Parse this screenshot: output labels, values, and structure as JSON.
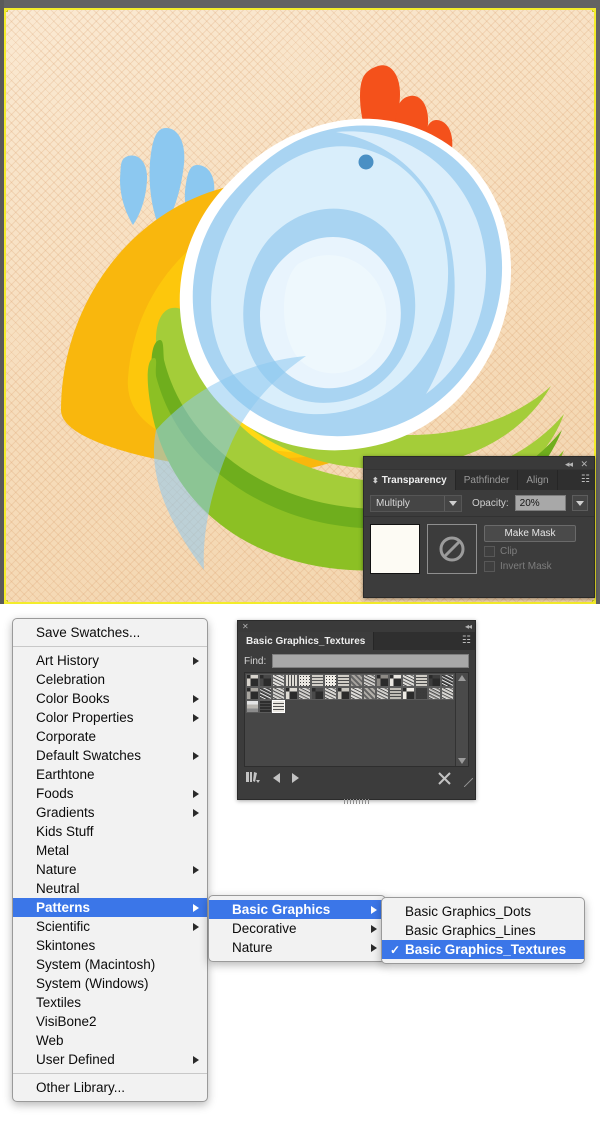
{
  "canvas": {
    "name": "artboard-illustration",
    "background_color": "#f6dfc0",
    "selection_border_color": "#f3ec2a",
    "app_chrome_color": "#636363",
    "artwork_description": "bird-illustration",
    "palette": {
      "orange_crest": "#f4511b",
      "orange_beak": "#ef4a12",
      "orange_beak_dark": "#cf3a13",
      "yellow_body": "#fdc70c",
      "yellow_body_light": "#ffd915",
      "yellow_deep": "#f9b70d",
      "blue_light": "#d9eefb",
      "blue_mid": "#a9d4f2",
      "blue_pale": "#e8f4fd",
      "blue_splash": "#8cc8f0",
      "blue_eye": "#4a90c4",
      "green_light": "#a4cd39",
      "green_mid": "#8cc024",
      "green_dark": "#6fae1d",
      "white_rim": "#ffffff"
    }
  },
  "transparency_panel": {
    "name": "transparency-panel",
    "collapse_icon": "◂◂",
    "close_icon": "✕",
    "menu_icon": "☷",
    "diamond_icon": "⬍",
    "tabs": [
      {
        "label": "Transparency",
        "active": true
      },
      {
        "label": "Pathfinder",
        "active": false
      },
      {
        "label": "Align",
        "active": false
      }
    ],
    "blend_mode": "Multiply",
    "opacity_label": "Opacity:",
    "opacity_value": "20%",
    "make_mask_label": "Make Mask",
    "clip_label": "Clip",
    "clip_checked": false,
    "invert_mask_label": "Invert Mask",
    "invert_mask_checked": false,
    "fill_thumb_color": "#fdfbf4",
    "mask_thumb_icon": "no-mask-symbol"
  },
  "swatch_library_panel": {
    "name": "swatch-library-panel",
    "close_icon": "✕",
    "collapse_icon": "◂◂",
    "menu_icon": "☷",
    "tab_title": "Basic Graphics_Textures",
    "find_label": "Find:",
    "find_value": "",
    "find_placeholder": "",
    "library_icon": "library-stack-icon",
    "prev_icon": "previous-library-arrow",
    "next_icon": "next-library-arrow",
    "delete_icon": "delete-swatch-icon",
    "resize_icon": "resize-grip-icon",
    "swatch_count": 35,
    "columns": 16,
    "swatches": [
      {
        "tone": "#d8d4cd",
        "pat": "speckle"
      },
      {
        "tone": "#484848",
        "pat": "speckle"
      },
      {
        "tone": "#e4e1db",
        "pat": "noise"
      },
      {
        "tone": "#dedbd4",
        "pat": "vlines"
      },
      {
        "tone": "#e8e5df",
        "pat": "dots"
      },
      {
        "tone": "#d2cfc8",
        "pat": "grid"
      },
      {
        "tone": "#eeebe5",
        "pat": "dots"
      },
      {
        "tone": "#d0cdc6",
        "pat": "hlines"
      },
      {
        "tone": "#a8a5a0",
        "pat": "diag"
      },
      {
        "tone": "#bab7b1",
        "pat": "noise"
      },
      {
        "tone": "#8d8a85",
        "pat": "speckle"
      },
      {
        "tone": "#e9e6e0",
        "pat": "speckle"
      },
      {
        "tone": "#dcd9d2",
        "pat": "noise"
      },
      {
        "tone": "#cfccc5",
        "pat": "hlines"
      },
      {
        "tone": "#3d3d3d",
        "pat": "speckle"
      },
      {
        "tone": "#2f2f2f",
        "pat": "noise"
      },
      {
        "tone": "#a9a6a0",
        "pat": "speckle"
      },
      {
        "tone": "#3a3a3a",
        "pat": "noise"
      },
      {
        "tone": "#c9c6bf",
        "pat": "noise"
      },
      {
        "tone": "#dedbd4",
        "pat": "speckle"
      },
      {
        "tone": "#c0bdb6",
        "pat": "noise"
      },
      {
        "tone": "#4a4a4a",
        "pat": "speckle"
      },
      {
        "tone": "#d6d3cc",
        "pat": "noise"
      },
      {
        "tone": "#cac7c0",
        "pat": "speckle"
      },
      {
        "tone": "#d9d6cf",
        "pat": "noise"
      },
      {
        "tone": "#b4b1ab",
        "pat": "diag"
      },
      {
        "tone": "#c4c1ba",
        "pat": "noise"
      },
      {
        "tone": "#bfbcb5",
        "pat": "hlines"
      },
      {
        "tone": "#efece6",
        "pat": "speckle"
      },
      {
        "tone": "#3c3c3c",
        "pat": "dots"
      },
      {
        "tone": "#9e9b96",
        "pat": "noise"
      },
      {
        "tone": "#cdcac3",
        "pat": "noise"
      },
      {
        "tone": "#b9b6b0",
        "pat": "hgrad"
      },
      {
        "tone": "#2e2e2e",
        "pat": "hlines"
      },
      {
        "tone": "#eae7e1",
        "pat": "grid"
      }
    ]
  },
  "swatches_menu": {
    "name": "swatch-libraries-menu",
    "save_item": "Save Swatches...",
    "items": [
      {
        "label": "Art History",
        "submenu": true,
        "selected": false
      },
      {
        "label": "Celebration",
        "submenu": false,
        "selected": false
      },
      {
        "label": "Color Books",
        "submenu": true,
        "selected": false
      },
      {
        "label": "Color Properties",
        "submenu": true,
        "selected": false
      },
      {
        "label": "Corporate",
        "submenu": false,
        "selected": false
      },
      {
        "label": "Default Swatches",
        "submenu": true,
        "selected": false
      },
      {
        "label": "Earthtone",
        "submenu": false,
        "selected": false
      },
      {
        "label": "Foods",
        "submenu": true,
        "selected": false
      },
      {
        "label": "Gradients",
        "submenu": true,
        "selected": false
      },
      {
        "label": "Kids Stuff",
        "submenu": false,
        "selected": false
      },
      {
        "label": "Metal",
        "submenu": false,
        "selected": false
      },
      {
        "label": "Nature",
        "submenu": true,
        "selected": false
      },
      {
        "label": "Neutral",
        "submenu": false,
        "selected": false
      },
      {
        "label": "Patterns",
        "submenu": true,
        "selected": true
      },
      {
        "label": "Scientific",
        "submenu": true,
        "selected": false
      },
      {
        "label": "Skintones",
        "submenu": false,
        "selected": false
      },
      {
        "label": "System (Macintosh)",
        "submenu": false,
        "selected": false
      },
      {
        "label": "System (Windows)",
        "submenu": false,
        "selected": false
      },
      {
        "label": "Textiles",
        "submenu": false,
        "selected": false
      },
      {
        "label": "VisiBone2",
        "submenu": false,
        "selected": false
      },
      {
        "label": "Web",
        "submenu": false,
        "selected": false
      },
      {
        "label": "User Defined",
        "submenu": true,
        "selected": false
      }
    ],
    "other_item": "Other Library...",
    "highlight_color": "#3b76e8"
  },
  "patterns_submenu": {
    "name": "patterns-submenu",
    "items": [
      {
        "label": "Basic Graphics",
        "submenu": true,
        "selected": true
      },
      {
        "label": "Decorative",
        "submenu": true,
        "selected": false
      },
      {
        "label": "Nature",
        "submenu": true,
        "selected": false
      }
    ]
  },
  "basic_graphics_submenu": {
    "name": "basic-graphics-submenu",
    "check_glyph": "✓",
    "items": [
      {
        "label": "Basic Graphics_Dots",
        "checked": false,
        "selected": false
      },
      {
        "label": "Basic Graphics_Lines",
        "checked": false,
        "selected": false
      },
      {
        "label": "Basic Graphics_Textures",
        "checked": true,
        "selected": true
      }
    ]
  }
}
